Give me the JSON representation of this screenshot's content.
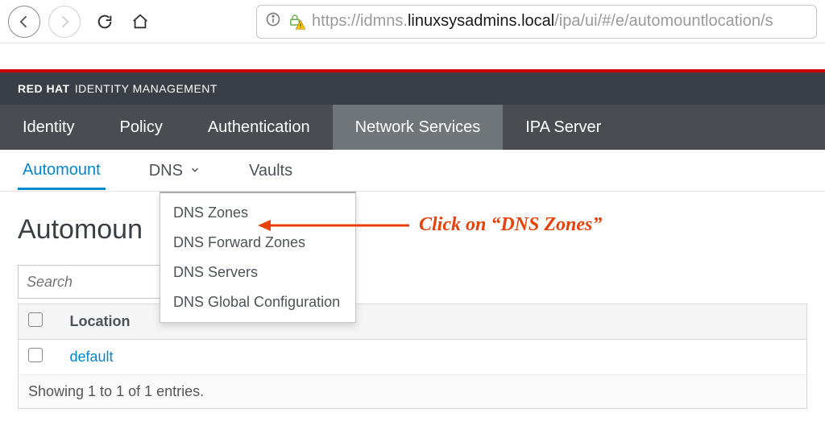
{
  "browser": {
    "url_prefix": "https://idmns.",
    "url_host_dark": "linuxsysadmins.local",
    "url_suffix": "/ipa/ui/#/e/automountlocation/s"
  },
  "brand": {
    "bold": "RED HAT",
    "thin": "IDENTITY MANAGEMENT"
  },
  "primary_nav": {
    "items": [
      {
        "label": "Identity"
      },
      {
        "label": "Policy"
      },
      {
        "label": "Authentication"
      },
      {
        "label": "Network Services"
      },
      {
        "label": "IPA Server"
      }
    ],
    "active_index": 3
  },
  "secondary_nav": {
    "automount": "Automount",
    "dns": "DNS",
    "vaults": "Vaults"
  },
  "dns_dropdown": {
    "items": [
      {
        "label": "DNS Zones"
      },
      {
        "label": "DNS Forward Zones"
      },
      {
        "label": "DNS Servers"
      },
      {
        "label": "DNS Global Configuration"
      }
    ]
  },
  "annotation": {
    "text": "Click on “DNS Zones”"
  },
  "page": {
    "title": "Automoun",
    "search_placeholder": "Search",
    "table": {
      "header_location": "Location",
      "rows": [
        {
          "location": "default"
        }
      ],
      "footer": "Showing 1 to 1 of 1 entries."
    }
  },
  "colors": {
    "accent": "#0088ce",
    "brand_red": "#c00",
    "annot": "#e8410a"
  }
}
